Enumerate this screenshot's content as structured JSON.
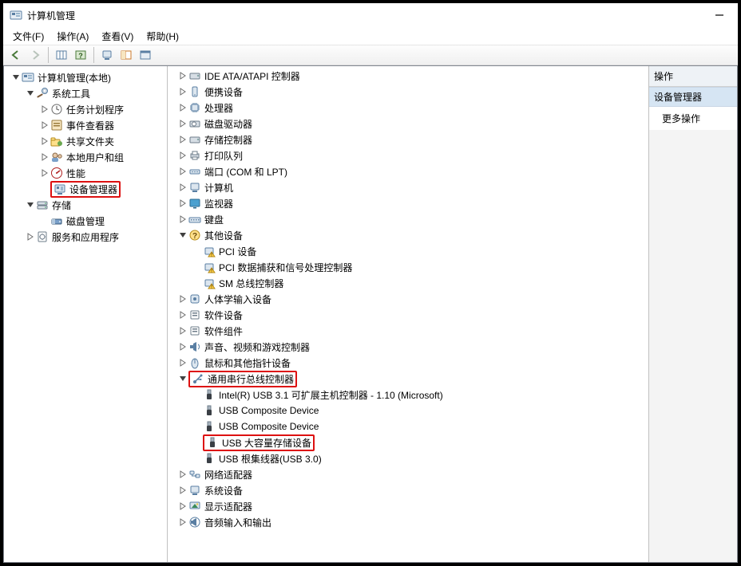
{
  "window": {
    "title": "计算机管理"
  },
  "menu": {
    "file": "文件(F)",
    "action": "操作(A)",
    "view": "查看(V)",
    "help": "帮助(H)"
  },
  "left": {
    "root": "计算机管理(本地)",
    "sys_tools": "系统工具",
    "task_scheduler": "任务计划程序",
    "event_viewer": "事件查看器",
    "shared_folders": "共享文件夹",
    "local_users": "本地用户和组",
    "performance": "性能",
    "device_manager": "设备管理器",
    "storage": "存储",
    "disk_mgmt": "磁盘管理",
    "services_apps": "服务和应用程序"
  },
  "mid": {
    "ide": "IDE ATA/ATAPI 控制器",
    "portable": "便携设备",
    "cpu": "处理器",
    "disk_drives": "磁盘驱动器",
    "storage_ctrl": "存储控制器",
    "print_queues": "打印队列",
    "ports": "端口 (COM 和 LPT)",
    "computers": "计算机",
    "monitors": "监视器",
    "keyboards": "键盘",
    "other_devices": "其他设备",
    "other_pci": "PCI 设备",
    "other_sigproc": "PCI 数据捕获和信号处理控制器",
    "other_smbus": "SM 总线控制器",
    "hid": "人体学输入设备",
    "software_devices": "软件设备",
    "software_components": "软件组件",
    "sound": "声音、视频和游戏控制器",
    "mice": "鼠标和其他指针设备",
    "usb_ctrl": "通用串行总线控制器",
    "usb_intel": "Intel(R) USB 3.1 可扩展主机控制器 - 1.10 (Microsoft)",
    "usb_comp1": "USB Composite Device",
    "usb_comp2": "USB Composite Device",
    "usb_mass": "USB 大容量存储设备",
    "usb_root": "USB 根集线器(USB 3.0)",
    "network": "网络适配器",
    "system_devices": "系统设备",
    "display": "显示适配器",
    "audio_io": "音频输入和输出"
  },
  "right": {
    "header": "操作",
    "section": "设备管理器",
    "more": "更多操作"
  }
}
